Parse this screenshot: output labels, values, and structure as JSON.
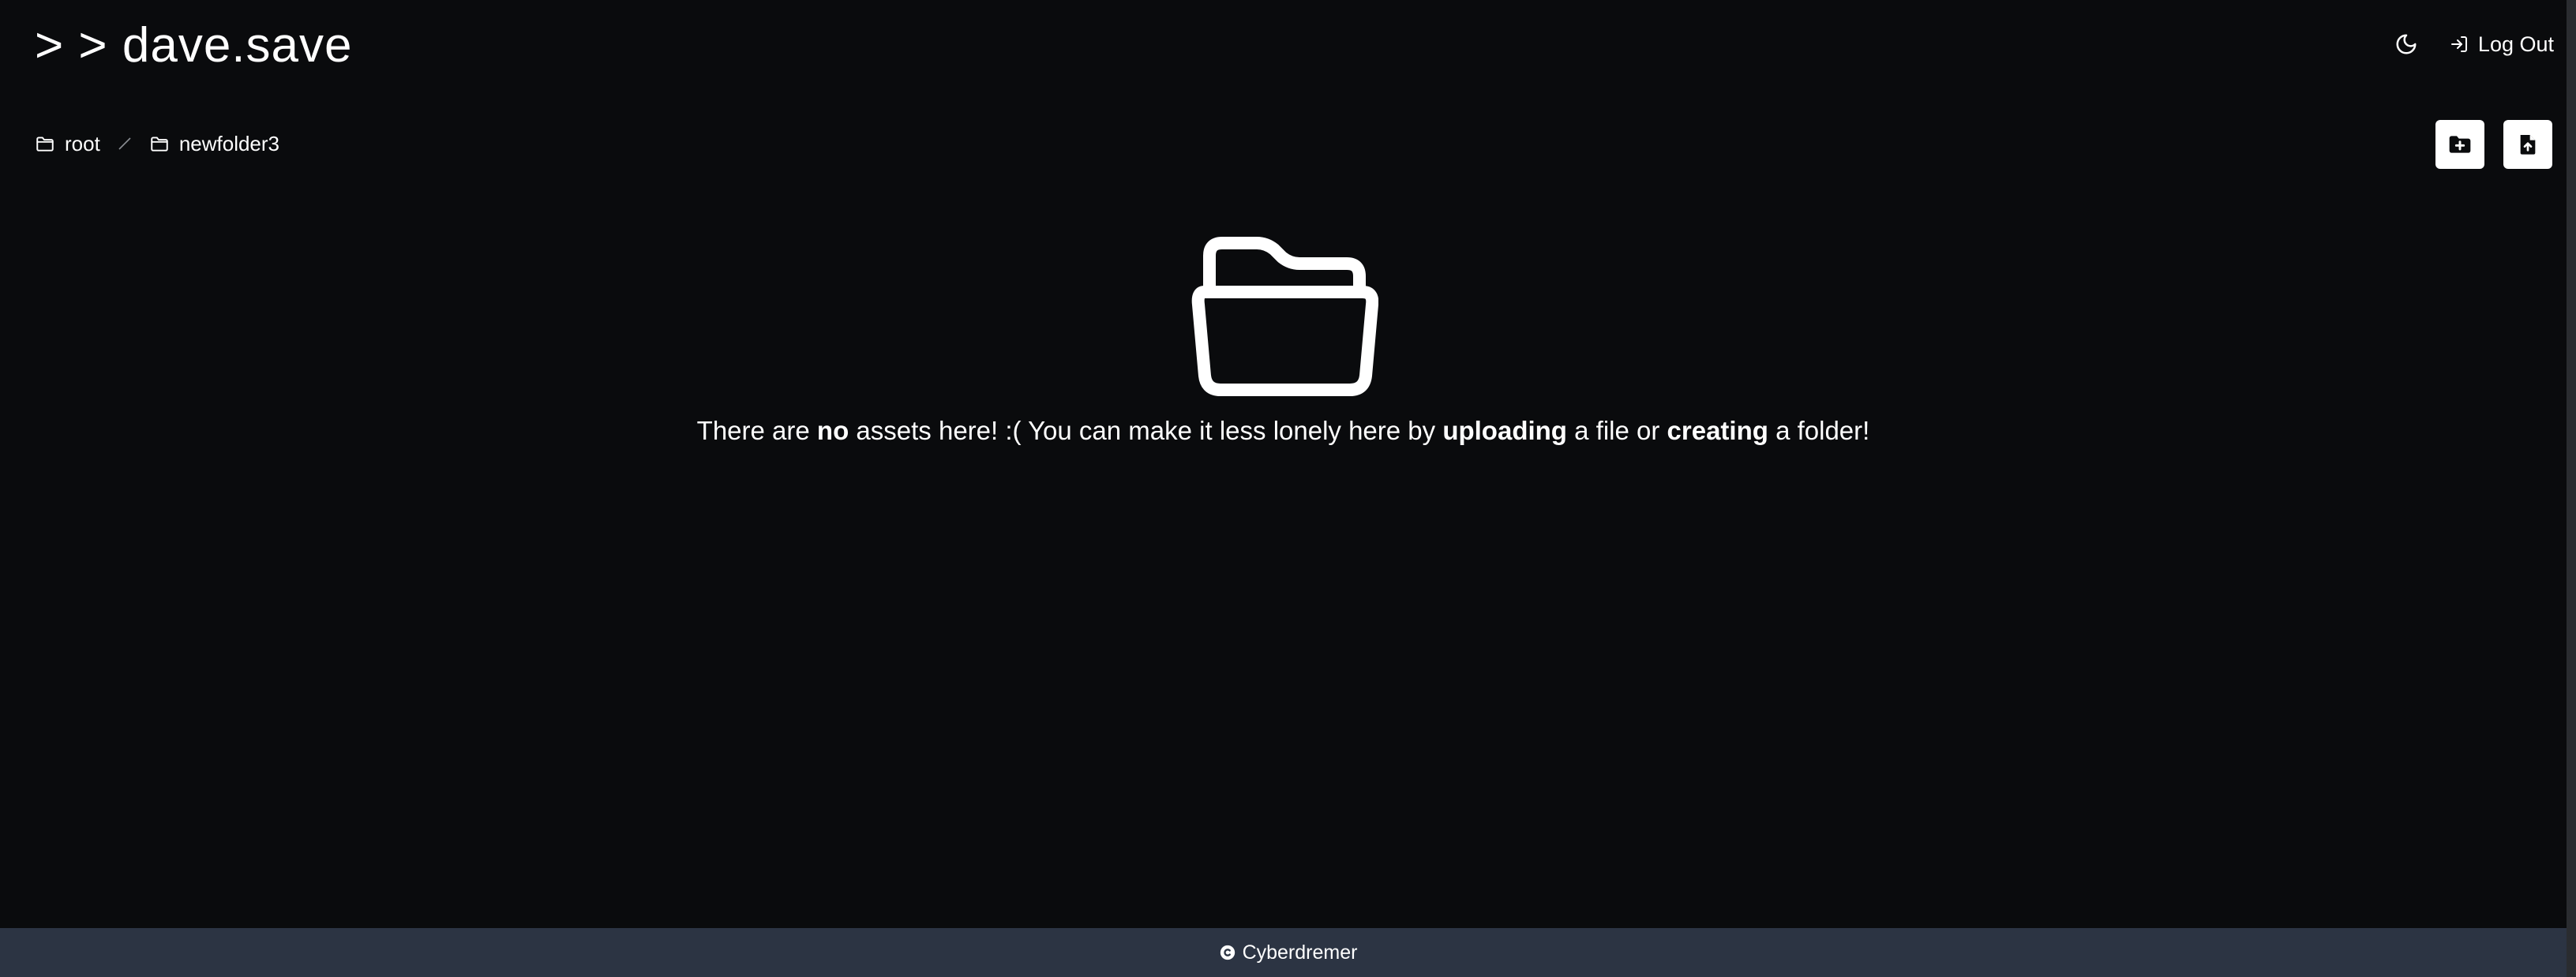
{
  "header": {
    "title": "> > dave.save",
    "theme_toggle_icon": "moon-icon",
    "logout_icon": "logout-icon",
    "logout_label": "Log Out"
  },
  "breadcrumb": {
    "items": [
      {
        "icon": "folder-icon",
        "label": "root"
      },
      {
        "icon": "folder-icon",
        "label": "newfolder3"
      }
    ],
    "separator": "/"
  },
  "toolbar": {
    "new_folder_icon": "folder-plus-icon",
    "upload_file_icon": "file-upload-icon"
  },
  "empty_state": {
    "icon": "folder-open-icon",
    "text_1": "There are ",
    "bold_1": "no",
    "text_2": " assets here! :( You can make it less lonely here by ",
    "bold_2": "uploading",
    "text_3": " a file or ",
    "bold_3": "creating",
    "text_4": " a folder!"
  },
  "footer": {
    "copyright_icon": "copyright-icon",
    "label": "Cyberdremer"
  },
  "colors": {
    "background": "#0a0b0d",
    "footer": "#2c3443",
    "text": "#ffffff"
  }
}
